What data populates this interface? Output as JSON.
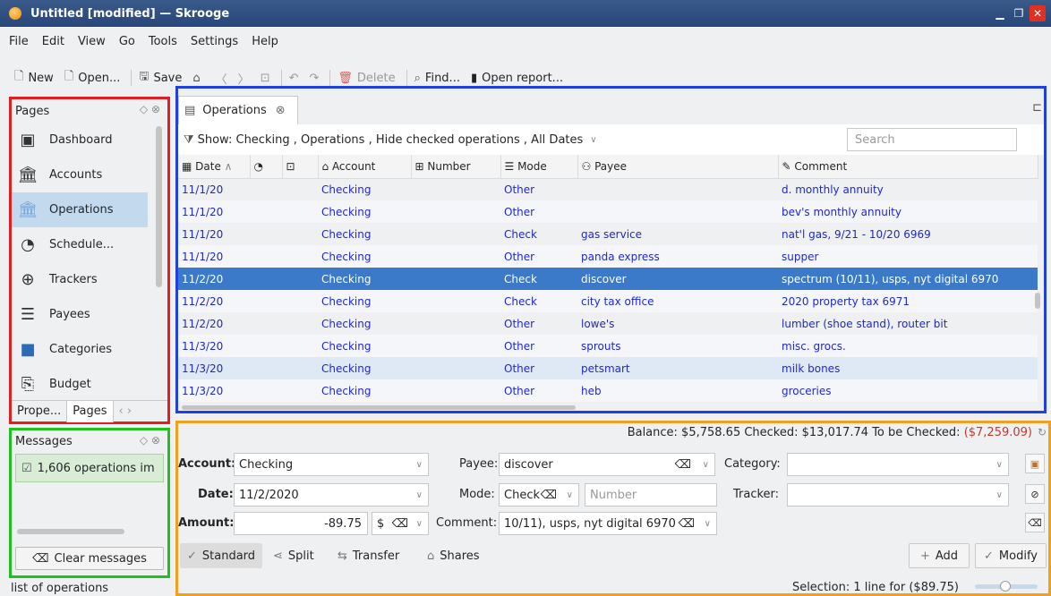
{
  "window": {
    "title": "Untitled [modified] — Skrooge"
  },
  "menu": [
    "File",
    "Edit",
    "View",
    "Go",
    "Tools",
    "Settings",
    "Help"
  ],
  "toolbar": {
    "new": "New",
    "open": "Open...",
    "save": "Save",
    "delete": "Delete",
    "find": "Find...",
    "open_report": "Open report..."
  },
  "pages": {
    "header": "Pages",
    "items": [
      {
        "label": "Dashboard",
        "icon": "dashboard-icon"
      },
      {
        "label": "Accounts",
        "icon": "bank-icon"
      },
      {
        "label": "Operations",
        "icon": "operations-icon"
      },
      {
        "label": "Schedule...",
        "icon": "schedule-icon"
      },
      {
        "label": "Trackers",
        "icon": "crosshair-icon"
      },
      {
        "label": "Payees",
        "icon": "payees-icon"
      },
      {
        "label": "Categories",
        "icon": "folder-icon"
      },
      {
        "label": "Budget",
        "icon": "budget-icon"
      }
    ],
    "tabs": [
      "Prope...",
      "Pages"
    ]
  },
  "messages": {
    "header": "Messages",
    "item": "1,606 operations im",
    "clear": "Clear messages"
  },
  "statusbar": {
    "left": "list of operations"
  },
  "operations": {
    "tab": "Operations",
    "filter": "Show: Checking , Operations , Hide checked operations , All Dates",
    "search_placeholder": "Search",
    "columns": [
      "Date",
      "",
      "",
      "Account",
      "Number",
      "Mode",
      "Payee",
      "Comment"
    ],
    "rows": [
      {
        "date": "11/1/20",
        "account": "Checking",
        "number": "",
        "mode": "Other",
        "payee": "",
        "comment": "d. monthly annuity"
      },
      {
        "date": "11/1/20",
        "account": "Checking",
        "number": "",
        "mode": "Other",
        "payee": "",
        "comment": "bev's monthly annuity"
      },
      {
        "date": "11/1/20",
        "account": "Checking",
        "number": "",
        "mode": "Check",
        "payee": "gas service",
        "comment": "nat'l gas, 9/21 - 10/20 6969"
      },
      {
        "date": "11/1/20",
        "account": "Checking",
        "number": "",
        "mode": "Other",
        "payee": "panda express",
        "comment": "supper"
      },
      {
        "date": "11/2/20",
        "account": "Checking",
        "number": "",
        "mode": "Check",
        "payee": "discover",
        "comment": "spectrum (10/11), usps, nyt digital 6970"
      },
      {
        "date": "11/2/20",
        "account": "Checking",
        "number": "",
        "mode": "Check",
        "payee": "city tax office",
        "comment": "2020 property tax 6971"
      },
      {
        "date": "11/2/20",
        "account": "Checking",
        "number": "",
        "mode": "Other",
        "payee": "lowe's",
        "comment": "lumber (shoe stand), router bit"
      },
      {
        "date": "11/3/20",
        "account": "Checking",
        "number": "",
        "mode": "Other",
        "payee": "sprouts",
        "comment": "misc. grocs."
      },
      {
        "date": "11/3/20",
        "account": "Checking",
        "number": "",
        "mode": "Other",
        "payee": "petsmart",
        "comment": "milk bones"
      },
      {
        "date": "11/3/20",
        "account": "Checking",
        "number": "",
        "mode": "Other",
        "payee": "heb",
        "comment": "groceries"
      }
    ],
    "selected_row": 4
  },
  "balance": {
    "text": "Balance: $5,758.65 Checked: $13,017.74 To be Checked: ",
    "to_be_checked": "($7,259.09)"
  },
  "edit": {
    "account_label": "Account:",
    "account_value": "Checking",
    "payee_label": "Payee:",
    "payee_value": "discover",
    "category_label": "Category:",
    "category_value": "",
    "date_label": "Date:",
    "date_value": "11/2/2020",
    "mode_label": "Mode:",
    "mode_value": "Check",
    "number_placeholder": "Number",
    "tracker_label": "Tracker:",
    "tracker_value": "",
    "amount_label": "Amount:",
    "amount_value": "-89.75",
    "currency": "$",
    "comment_label": "Comment:",
    "comment_value": "10/11), usps, nyt digital 6970",
    "modes": [
      "Standard",
      "Split",
      "Transfer",
      "Shares"
    ],
    "add": "Add",
    "modify": "Modify",
    "selection": "Selection: 1 line for ($89.75)"
  },
  "colors": {
    "selected_row": "#3b7ac8",
    "link_text": "#2028c8",
    "negative": "#c0392b"
  }
}
